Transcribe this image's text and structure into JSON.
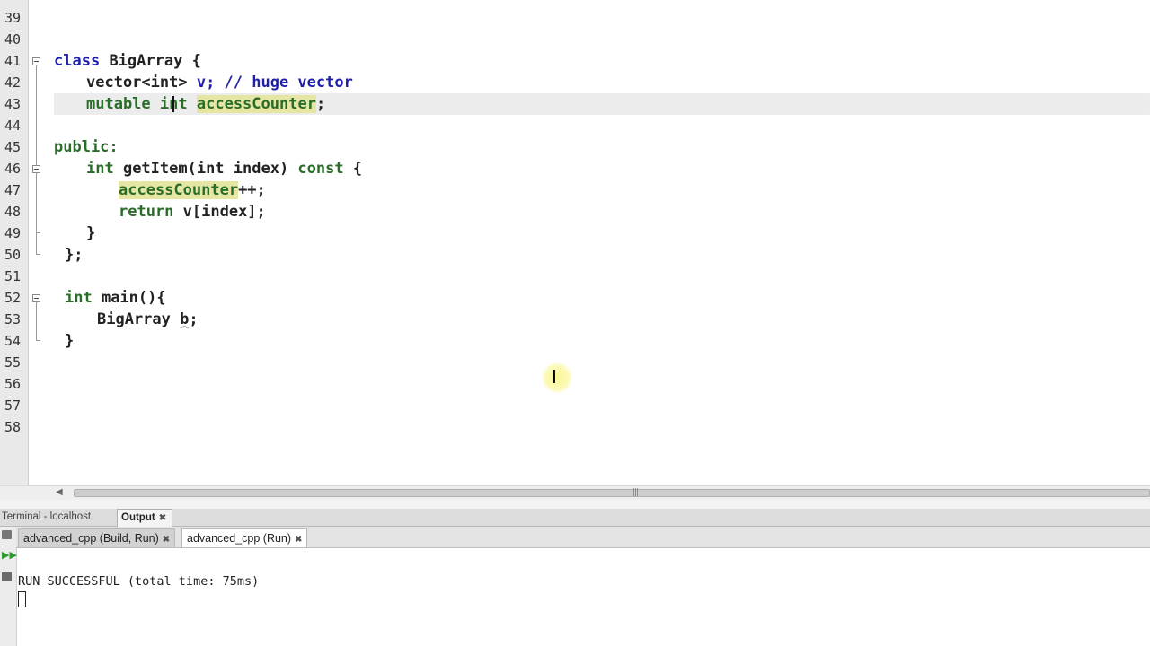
{
  "editor": {
    "line_numbers": [
      "39",
      "40",
      "41",
      "42",
      "43",
      "44",
      "45",
      "46",
      "47",
      "48",
      "49",
      "50",
      "51",
      "52",
      "53",
      "54",
      "55",
      "56",
      "57",
      "58"
    ],
    "code": {
      "l41": {
        "kw_class": "class",
        "name": "BigArray",
        "brace": " {"
      },
      "l42": {
        "type": "vector<int>",
        "rest": " v; // huge vector"
      },
      "l43": {
        "kw_mutable": "mutable",
        "type_int": "int",
        "field": "accessCounter",
        "semi": ";"
      },
      "l45": {
        "kw_public": "public:"
      },
      "l46": {
        "type_int": "int",
        "sig": " getItem(int index) ",
        "kw_const": "const",
        "brace": " {"
      },
      "l47": {
        "field": "accessCounter",
        "rest": "++;"
      },
      "l48": {
        "kw_return": "return",
        "rest": " v[index];"
      },
      "l49": {
        "close": "}"
      },
      "l50": {
        "close": "};"
      },
      "l52": {
        "type_int": "int",
        "rest": " main(){"
      },
      "l53": {
        "name": "BigArray",
        "var": "b",
        "semi": ";"
      },
      "l54": {
        "close": "}"
      }
    },
    "colors": {
      "keyword": "#1f1fa8",
      "type": "#2a6c2a",
      "highlight": "#e6e6a4"
    }
  },
  "panel": {
    "tabs": [
      {
        "label": "Terminal - localhost"
      },
      {
        "label": "Output",
        "close": "✖"
      }
    ],
    "subtabs": [
      {
        "label": "advanced_cpp (Build, Run)",
        "close": "✖"
      },
      {
        "label": "advanced_cpp (Run)",
        "close": "✖"
      }
    ],
    "side_icons": [
      "stop-icon",
      "rerun-icon",
      "rerun-again-icon",
      "clear-icon"
    ],
    "output_text": "RUN SUCCESSFUL (total time: 75ms)"
  }
}
